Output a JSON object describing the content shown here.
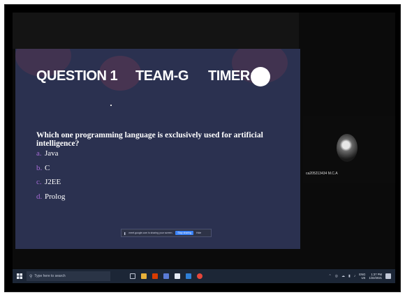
{
  "slide": {
    "question_label": "QUESTION 1",
    "team_label": "TEAM-G",
    "timer_label": "TIMER:",
    "question_text": "Which one programming language is exclusively used for artificial intelligence?",
    "options": [
      {
        "letter": "a.",
        "text": "Java"
      },
      {
        "letter": "b.",
        "text": "C"
      },
      {
        "letter": "c.",
        "text": "J2EE"
      },
      {
        "letter": "d.",
        "text": "Prolog"
      }
    ]
  },
  "share_bar": {
    "message": "meet.google.com is sharing your screen.",
    "stop_label": "Stop sharing",
    "hide_label": "Hide"
  },
  "participant": {
    "name": "ca205213434 M.C.A"
  },
  "taskbar": {
    "search_placeholder": "Type here to search",
    "language": "ENG",
    "region": "US",
    "time": "1:37 PM",
    "date": "1/22/2021"
  },
  "colors": {
    "slide_bg": "#2b3150",
    "option_letter": "#a66bd6",
    "taskbar_bg": "#1c2636",
    "stop_button": "#3b82f6"
  }
}
